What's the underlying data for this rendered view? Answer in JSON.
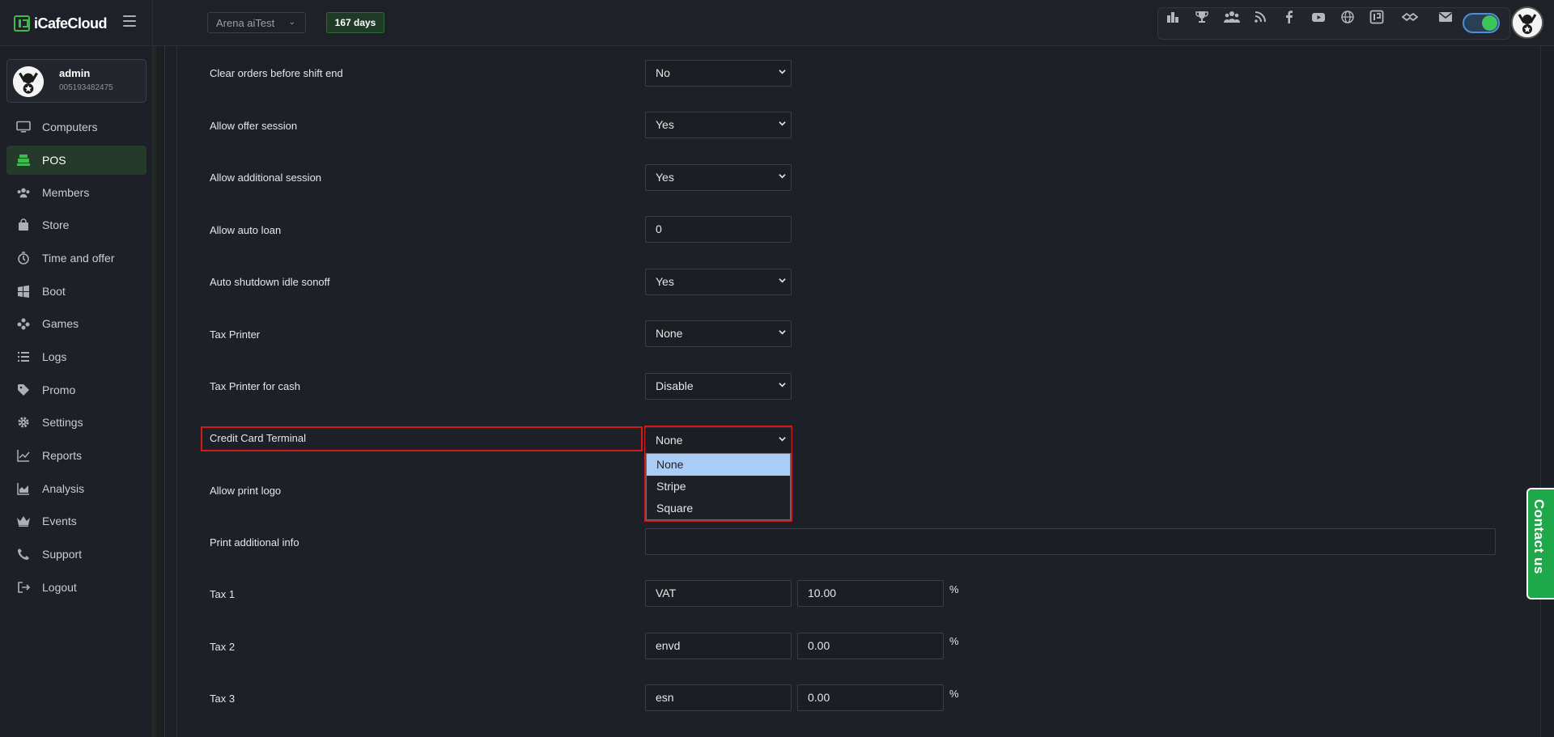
{
  "app": {
    "logo_text": "iCafeCloud",
    "arena_select": "Arena aiTest",
    "days_badge": "167 days"
  },
  "topbar_icons": [
    "leaderboard-icon",
    "trophy-icon",
    "users-group-icon",
    "rss-icon",
    "facebook-icon",
    "youtube-icon",
    "globe-icon",
    "icafe-icon",
    "handshake-icon",
    "mail-icon"
  ],
  "user": {
    "name": "admin",
    "id": "005193482475"
  },
  "sidebar": {
    "items": [
      {
        "label": "Computers",
        "icon": "monitor-icon"
      },
      {
        "label": "POS",
        "icon": "cash-register-icon"
      },
      {
        "label": "Members",
        "icon": "members-icon"
      },
      {
        "label": "Store",
        "icon": "store-bag-icon"
      },
      {
        "label": "Time and offer",
        "icon": "stopwatch-icon"
      },
      {
        "label": "Boot",
        "icon": "windows-icon"
      },
      {
        "label": "Games",
        "icon": "gamepad-icon"
      },
      {
        "label": "Logs",
        "icon": "list-icon"
      },
      {
        "label": "Promo",
        "icon": "tag-icon"
      },
      {
        "label": "Settings",
        "icon": "gear-icon"
      },
      {
        "label": "Reports",
        "icon": "line-chart-icon"
      },
      {
        "label": "Analysis",
        "icon": "area-chart-icon"
      },
      {
        "label": "Events",
        "icon": "crown-icon"
      },
      {
        "label": "Support",
        "icon": "phone-icon"
      },
      {
        "label": "Logout",
        "icon": "logout-icon"
      }
    ],
    "active": "POS"
  },
  "settings": {
    "clear_orders": {
      "label": "Clear orders before shift end",
      "value": "No"
    },
    "offer_session": {
      "label": "Allow offer session",
      "value": "Yes"
    },
    "additional_session": {
      "label": "Allow additional session",
      "value": "Yes"
    },
    "auto_loan": {
      "label": "Allow auto loan",
      "value": "0"
    },
    "auto_shutdown": {
      "label": "Auto shutdown idle sonoff",
      "value": "Yes"
    },
    "tax_printer": {
      "label": "Tax Printer",
      "value": "None"
    },
    "tax_printer_cash": {
      "label": "Tax Printer for cash",
      "value": "Disable"
    },
    "credit_card_terminal": {
      "label": "Credit Card Terminal",
      "value": "None",
      "options": [
        "None",
        "Stripe",
        "Square"
      ]
    },
    "print_logo": {
      "label": "Allow print logo"
    },
    "print_additional_info": {
      "label": "Print additional info",
      "value": ""
    },
    "tax1": {
      "label": "Tax 1",
      "name": "VAT",
      "rate": "10.00",
      "unit": "%"
    },
    "tax2": {
      "label": "Tax 2",
      "name": "envd",
      "rate": "0.00",
      "unit": "%"
    },
    "tax3": {
      "label": "Tax 3",
      "name": "esn",
      "rate": "0.00",
      "unit": "%"
    }
  },
  "contact_tab": "Contact us",
  "colors": {
    "accent_green": "#3fb950",
    "highlight_red": "#d11b1b",
    "selected_option": "#a9cdf7"
  }
}
